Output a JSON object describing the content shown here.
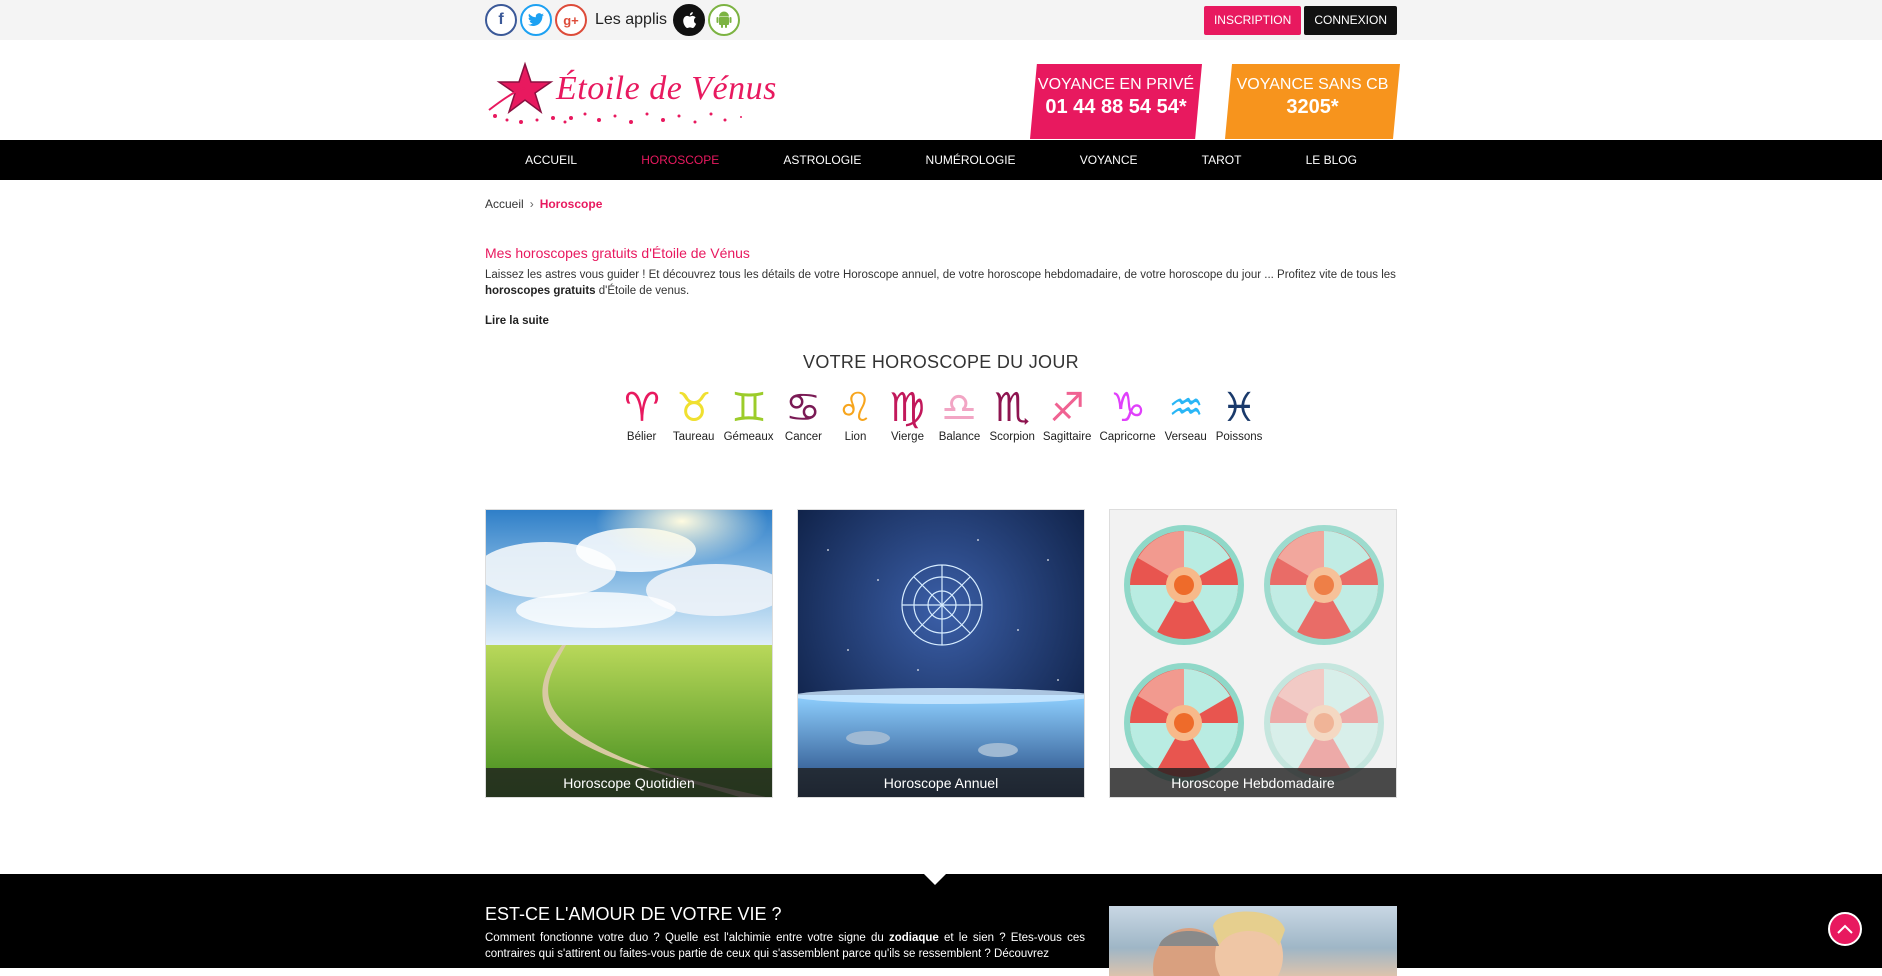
{
  "topbar": {
    "social": [
      {
        "name": "facebook-icon",
        "glyph": "f"
      },
      {
        "name": "twitter-icon",
        "glyph": "t"
      },
      {
        "name": "google-plus-icon",
        "glyph": "g+"
      }
    ],
    "applis_label": "Les applis",
    "inscription": "INSCRIPTION",
    "connexion": "CONNEXION"
  },
  "header": {
    "logo_text": "Étoile de Vénus",
    "promo_prive": {
      "line1": "VOYANCE EN PRIVÉ",
      "line2": "01 44 88 54 54*"
    },
    "promo_sanscb": {
      "line1": "VOYANCE SANS CB",
      "line2": "3205*"
    }
  },
  "nav": {
    "items": [
      "ACCUEIL",
      "HOROSCOPE",
      "ASTROLOGIE",
      "NUMÉROLOGIE",
      "VOYANCE",
      "TAROT",
      "LE BLOG"
    ]
  },
  "breadcrumb": {
    "home": "Accueil",
    "current": "Horoscope"
  },
  "intro": {
    "title": "Mes horoscopes gratuits d'Étoile de Vénus",
    "text_before": "Laissez les astres vous guider ! Et découvrez tous les détails de votre Horoscope annuel, de votre horoscope hebdomadaire, de votre horoscope du jour ... Profitez vite de tous les ",
    "text_bold": "horoscopes gratuits",
    "text_after": " d'Étoile de venus.",
    "more": "Lire la suite"
  },
  "horoscope_day": {
    "title": "VOTRE HOROSCOPE DU JOUR",
    "signs": [
      {
        "name": "Bélier",
        "glyph": "♈",
        "color": "#e8195f"
      },
      {
        "name": "Taureau",
        "glyph": "♉",
        "color": "#f0e030"
      },
      {
        "name": "Gémeaux",
        "glyph": "♊",
        "color": "#9ccc2a"
      },
      {
        "name": "Cancer",
        "glyph": "♋",
        "color": "#7a1a55"
      },
      {
        "name": "Lion",
        "glyph": "♌",
        "color": "#f7a51d"
      },
      {
        "name": "Vierge",
        "glyph": "♍",
        "color": "#c2185b"
      },
      {
        "name": "Balance",
        "glyph": "♎",
        "color": "#f2a5c4"
      },
      {
        "name": "Scorpion",
        "glyph": "♏",
        "color": "#8e1450"
      },
      {
        "name": "Sagittaire",
        "glyph": "♐",
        "color": "#f06292"
      },
      {
        "name": "Capricorne",
        "glyph": "♑",
        "color": "#e040fb"
      },
      {
        "name": "Verseau",
        "glyph": "♒",
        "color": "#29b6f6"
      },
      {
        "name": "Poissons",
        "glyph": "♓",
        "color": "#1a3a6b"
      }
    ]
  },
  "cards": [
    {
      "caption": "Horoscope Quotidien"
    },
    {
      "caption": "Horoscope Annuel"
    },
    {
      "caption": "Horoscope Hebdomadaire"
    }
  ],
  "love": {
    "title": "EST-CE L'AMOUR DE VOTRE VIE ?",
    "text_before": "Comment fonctionne votre duo ? Quelle est l'alchimie entre votre signe du ",
    "text_bold": "zodiaque",
    "text_after": " et le sien ? Etes-vous ces contraires qui s'attirent ou faites-vous partie de ceux qui s'assemblent parce qu'ils se ressemblent ? Découvrez"
  },
  "colors": {
    "accent": "#e8195f",
    "orange": "#f7941d",
    "nav_bg": "#000000"
  }
}
